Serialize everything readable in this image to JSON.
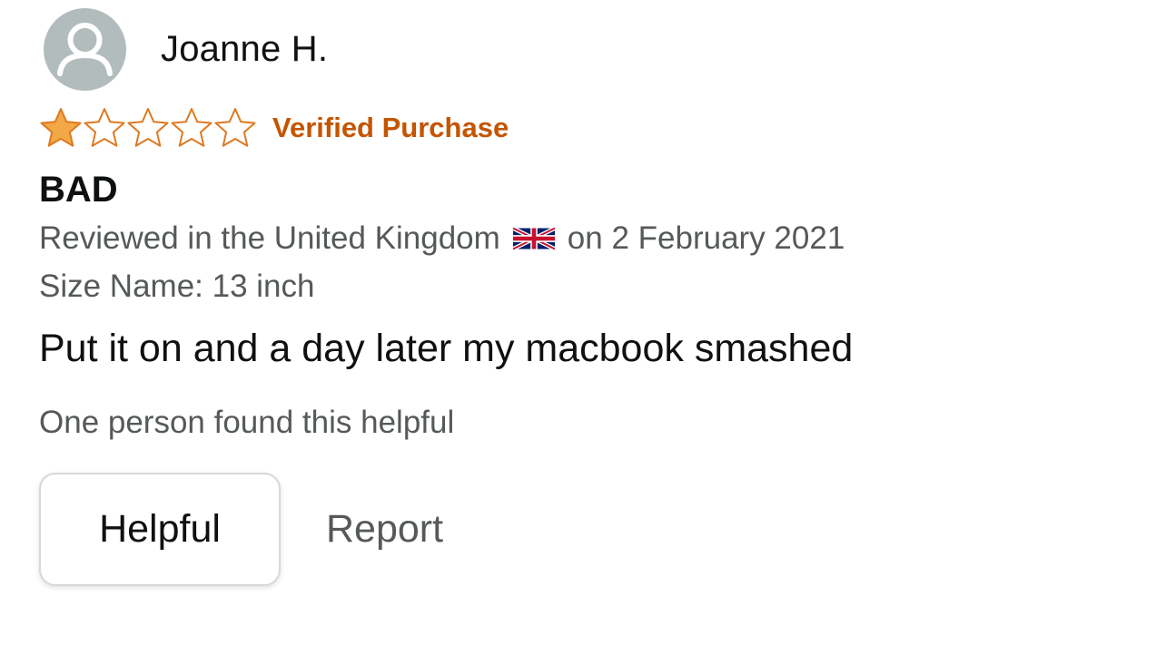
{
  "reviewer": {
    "name": "Joanne H.",
    "avatar_icon": "user-silhouette-icon",
    "avatar_bg": "#b3bcbc"
  },
  "rating": {
    "stars_filled": 1,
    "stars_total": 5,
    "star_color": "#f3a847",
    "star_outline_color": "#de7921",
    "verified_label": "Verified Purchase",
    "verified_color": "#c45500"
  },
  "review": {
    "title": "BAD",
    "reviewed_prefix": "Reviewed in the United Kingdom",
    "flag_icon": "uk-flag-icon",
    "reviewed_suffix": "on 2 February 2021",
    "size_line": "Size Name: 13 inch",
    "body": "Put it on and a day later my macbook smashed",
    "helpful_count": "One person found this helpful"
  },
  "actions": {
    "helpful_label": "Helpful",
    "report_label": "Report"
  }
}
